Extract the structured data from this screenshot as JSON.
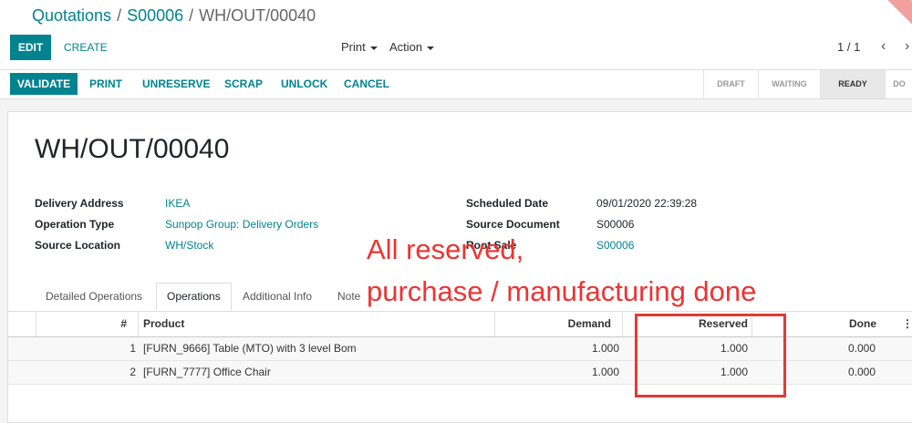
{
  "breadcrumb": {
    "items": [
      "Quotations",
      "S00006",
      "WH/OUT/00040"
    ]
  },
  "toolbar": {
    "edit_label": "EDIT",
    "create_label": "CREATE",
    "print_label": "Print",
    "action_label": "Action",
    "pager": "1 / 1",
    "prev_icon": "‹",
    "next_icon": "›"
  },
  "actions": {
    "validate": "VALIDATE",
    "print": "PRINT",
    "unreserve": "UNRESERVE",
    "scrap": "SCRAP",
    "unlock": "UNLOCK",
    "cancel": "CANCEL"
  },
  "stages": {
    "items": [
      "DRAFT",
      "WAITING",
      "READY",
      "DO"
    ],
    "active": "READY"
  },
  "record": {
    "name": "WH/OUT/00040",
    "fields_left": [
      {
        "label": "Delivery Address",
        "value": "IKEA"
      },
      {
        "label": "Operation Type",
        "value": "Sunpop Group: Delivery Orders"
      },
      {
        "label": "Source Location",
        "value": "WH/Stock"
      }
    ],
    "fields_right": [
      {
        "label": "Scheduled Date",
        "value": "09/01/2020 22:39:28"
      },
      {
        "label": "Source Document",
        "value": "S00006"
      },
      {
        "label": "Root Sale",
        "value": "S00006"
      }
    ]
  },
  "tabs": {
    "items": [
      "Detailed Operations",
      "Operations",
      "Additional Info",
      "Note"
    ],
    "active": "Operations"
  },
  "table": {
    "headers": {
      "num": "#",
      "product": "Product",
      "demand": "Demand",
      "reserved": "Reserved",
      "done": "Done",
      "menu": "⋮"
    },
    "rows": [
      {
        "num": "1",
        "product": "[FURN_9666] Table (MTO) with 3 level Bom",
        "demand": "1.000",
        "reserved": "1.000",
        "done": "0.000"
      },
      {
        "num": "2",
        "product": "[FURN_7777] Office Chair",
        "demand": "1.000",
        "reserved": "1.000",
        "done": "0.000"
      }
    ]
  },
  "annotation": {
    "line1": "All reserved,",
    "line2": "purchase / manufacturing done",
    "color": "#e53935"
  },
  "colors": {
    "accent": "#00838f"
  }
}
